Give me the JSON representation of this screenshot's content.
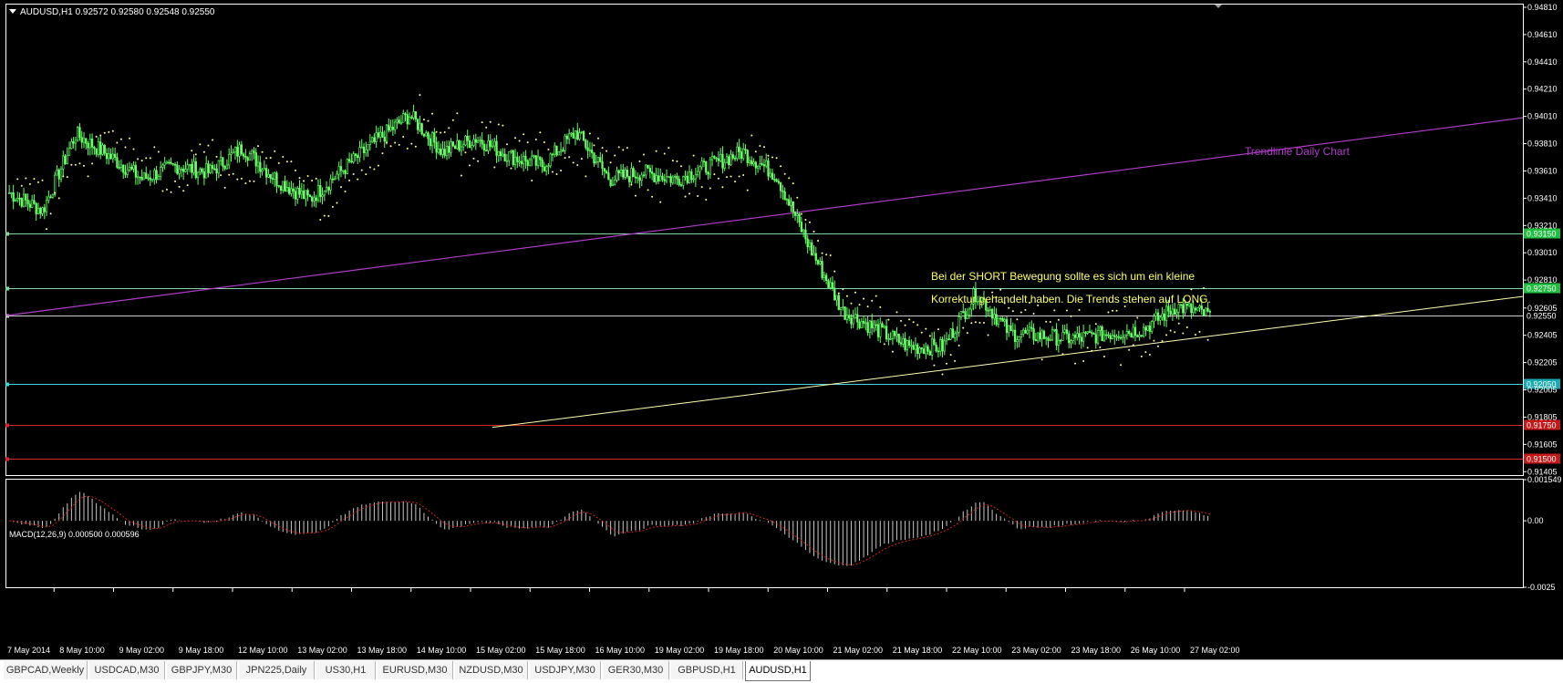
{
  "window": {
    "symbol_header": "AUDUSD,H1  0.92572 0.92580 0.92548 0.92550",
    "menu_icon": "triangle-down-icon",
    "annotation_line1": "Bei der SHORT Bewegung sollte es sich um ein kleine",
    "annotation_line2": "Korrektur gehandelt haben. Die Trends stehen auf LONG.",
    "trendline_label": "Trendlinie Daily Chart"
  },
  "colors": {
    "background": "#000000",
    "grid": "#ffffff",
    "candle": "#66ff66",
    "sar": "#ffff99",
    "support_line": "#7fd7a0",
    "magenta_trend": "#b13bc9",
    "yellow_trend": "#ffffb0",
    "red_line": "#d42626",
    "cyan_line": "#42d5d5",
    "macd_hist": "#c8c8c8",
    "macd_signal": "#d02020",
    "annotation_text": "#ffff66"
  },
  "price_axis": {
    "min": 0.9138,
    "max": 0.9483,
    "ticks": [
      "0.94810",
      "0.94610",
      "0.94410",
      "0.94210",
      "0.94010",
      "0.93810",
      "0.93610",
      "0.93410",
      "0.93210",
      "0.93010",
      "0.92810",
      "0.92605",
      "0.92405",
      "0.92205",
      "0.92005",
      "0.91805",
      "0.91605",
      "0.91405"
    ]
  },
  "horizontal_lines": [
    {
      "price": 0.9315,
      "label": "0.93150",
      "color": "#7fd7a0",
      "label_bg": "#1fbf3f"
    },
    {
      "price": 0.9275,
      "label": "0.92750",
      "color": "#7fd7a0",
      "label_bg": "#1fbf3f"
    },
    {
      "price": 0.9255,
      "label": "0.92550",
      "color": "#cccccc",
      "label_bg": "#000000"
    },
    {
      "price": 0.9205,
      "label": "0.92050",
      "color": "#42d5d5",
      "label_bg": "#19a9b0"
    },
    {
      "price": 0.9175,
      "label": "0.91750",
      "color": "#d42626",
      "label_bg": "#c41a1a"
    },
    {
      "price": 0.915,
      "label": "0.91500",
      "color": "#d42626",
      "label_bg": "#c41a1a"
    }
  ],
  "time_axis": {
    "labels": [
      "7 May 2014",
      "8 May 10:00",
      "9 May 02:00",
      "9 May 18:00",
      "12 May 10:00",
      "13 May 02:00",
      "13 May 18:00",
      "14 May 10:00",
      "15 May 02:00",
      "15 May 18:00",
      "16 May 10:00",
      "19 May 02:00",
      "19 May 18:00",
      "20 May 10:00",
      "21 May 02:00",
      "21 May 18:00",
      "22 May 10:00",
      "23 May 02:00",
      "23 May 18:00",
      "26 May 10:00",
      "27 May 02:00"
    ]
  },
  "macd": {
    "header": "MACD(12,26,9) 0.000500 0.000596",
    "ticks": [
      "0.001549",
      "0.00",
      "-0.0025"
    ],
    "max": 0.001549,
    "min": -0.0025
  },
  "chart_data": {
    "type": "candlestick",
    "symbol": "AUDUSD",
    "timeframe": "H1",
    "ohlc_last": {
      "open": 0.92572,
      "high": 0.9258,
      "low": 0.92548,
      "close": 0.9255
    },
    "close_path": [
      [
        0,
        0.9345
      ],
      [
        1,
        0.9332
      ],
      [
        2,
        0.9388
      ],
      [
        3,
        0.9372
      ],
      [
        4,
        0.9355
      ],
      [
        5,
        0.9365
      ],
      [
        6,
        0.936
      ],
      [
        7,
        0.9378
      ],
      [
        8,
        0.9355
      ],
      [
        9,
        0.934
      ],
      [
        10,
        0.9362
      ],
      [
        11,
        0.9383
      ],
      [
        12,
        0.9402
      ],
      [
        13,
        0.9375
      ],
      [
        14,
        0.9385
      ],
      [
        15,
        0.9372
      ],
      [
        16,
        0.9365
      ],
      [
        17,
        0.939
      ],
      [
        18,
        0.9355
      ],
      [
        19,
        0.936
      ],
      [
        20,
        0.9355
      ],
      [
        21,
        0.9365
      ],
      [
        22,
        0.9375
      ],
      [
        23,
        0.9358
      ],
      [
        24,
        0.9305
      ],
      [
        25,
        0.9258
      ],
      [
        26,
        0.9245
      ],
      [
        27,
        0.9232
      ],
      [
        28,
        0.9232
      ],
      [
        29,
        0.9272
      ],
      [
        30,
        0.9242
      ],
      [
        31,
        0.924
      ],
      [
        32,
        0.9238
      ],
      [
        33,
        0.9242
      ],
      [
        34,
        0.9245
      ],
      [
        35,
        0.9262
      ],
      [
        36,
        0.9255
      ]
    ],
    "sar_note": "Parabolic SAR dots above price in downtrends, below in uptrends",
    "trendlines": [
      {
        "name": "Trendlinie Daily Chart",
        "from": [
          "7 May 2014",
          0.9255
        ],
        "to": [
          "end",
          0.94
        ]
      },
      {
        "name": "",
        "from": [
          "15 May 02:00",
          0.9173
        ],
        "to": [
          "end",
          0.9269
        ]
      }
    ]
  },
  "tabs": [
    {
      "label": "GBPCAD,Weekly",
      "active": false
    },
    {
      "label": "USDCAD,M30",
      "active": false
    },
    {
      "label": "GBPJPY,M30",
      "active": false
    },
    {
      "label": "JPN225,Daily",
      "active": false
    },
    {
      "label": "US30,H1",
      "active": false
    },
    {
      "label": "EURUSD,M30",
      "active": false
    },
    {
      "label": "NZDUSD,M30",
      "active": false
    },
    {
      "label": "USDJPY,M30",
      "active": false
    },
    {
      "label": "GER30,M30",
      "active": false
    },
    {
      "label": "GBPUSD,H1",
      "active": false
    },
    {
      "label": "AUDUSD,H1",
      "active": true
    }
  ]
}
